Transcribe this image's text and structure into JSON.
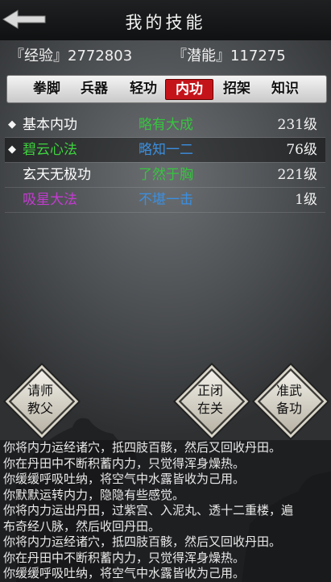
{
  "header": {
    "title": "我的技能"
  },
  "stats": {
    "exp": "『经验』2772803",
    "potential": "『潜能』117275"
  },
  "tabs": [
    "拳脚",
    "兵器",
    "轻功",
    "内功",
    "招架",
    "知识"
  ],
  "active_tab": "内功",
  "skills": [
    {
      "name": "基本内功",
      "level_text": "略有大成",
      "grade": "231级",
      "marker": "◆",
      "name_color": "#ffffff",
      "level_color": "#37c43f"
    },
    {
      "name": "碧云心法",
      "level_text": "略知一二",
      "grade": "76级",
      "marker": "◆",
      "name_color": "#3fd23f",
      "level_color": "#3b8fe0"
    },
    {
      "name": "玄天无极功",
      "level_text": "了然于胸",
      "grade": "221级",
      "marker": "",
      "name_color": "#ffffff",
      "level_color": "#37c43f"
    },
    {
      "name": "吸星大法",
      "level_text": "不堪一击",
      "grade": "1级",
      "marker": "",
      "name_color": "#c33bd1",
      "level_color": "#3b8fe0"
    }
  ],
  "buttons": {
    "teacher": "请师\n教父",
    "close": "正闭\n在关",
    "prepare": "准武\n备功"
  },
  "log": [
    "你将内力运经诸穴，抵四肢百骸，然后又回收丹田。",
    "你在丹田中不断积蓄内力，只觉得浑身燥热。",
    "你缓缓呼吸吐纳，将空气中水露皆收为己用。",
    "你默默运转内力，隐隐有些感觉。",
    "你将内力运出丹田，过紫宫、入泥丸、透十二重楼，遍",
    "布奇经八脉，然后收回丹田。",
    "你将内力运经诸穴，抵四肢百骸，然后又回收丹田。",
    "你在丹田中不断积蓄内力，只觉得浑身燥热。",
    "你缓缓呼吸吐纳，将空气中水露皆收为己用。"
  ]
}
